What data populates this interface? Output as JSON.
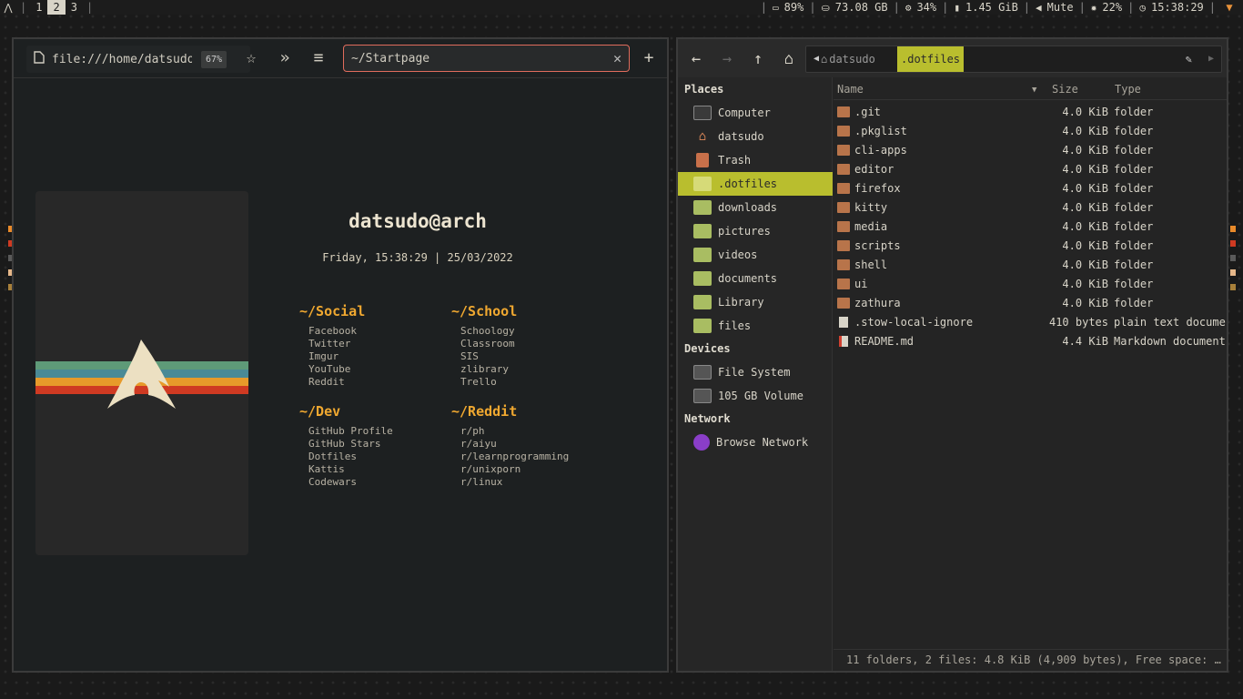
{
  "topbar": {
    "workspaces": [
      "1",
      "2",
      "3"
    ],
    "active_workspace": "2",
    "status": {
      "battery": "89%",
      "disk": "73.08 GB",
      "cpu": "34%",
      "memory": "1.45 GiB",
      "volume": "Mute",
      "brightness": "22%",
      "clock": "15:38:29"
    }
  },
  "browser": {
    "url": "file:///home/datsudo/",
    "zoom": "67%",
    "search_value": "~/Startpage",
    "startpage": {
      "host": "datsudo@arch",
      "datetime": "Friday, 15:38:29 | 25/03/2022",
      "sections": [
        {
          "title": "~/Social",
          "links": [
            "Facebook",
            "Twitter",
            "Imgur",
            "YouTube",
            "Reddit"
          ]
        },
        {
          "title": "~/School",
          "links": [
            "Schoology",
            "Classroom",
            "SIS",
            "zlibrary",
            "Trello"
          ]
        },
        {
          "title": "~/Dev",
          "links": [
            "GitHub Profile",
            "GitHub Stars",
            "Dotfiles",
            "Kattis",
            "Codewars"
          ]
        },
        {
          "title": "~/Reddit",
          "links": [
            "r/ph",
            "r/aiyu",
            "r/learnprogramming",
            "r/unixporn",
            "r/linux"
          ]
        }
      ]
    },
    "colors": {
      "accent": "#f0a830",
      "stripe_green": "#5e9a78",
      "stripe_blue": "#4a8a96",
      "stripe_orange": "#e79a2a",
      "stripe_red": "#cf3a22"
    }
  },
  "file_manager": {
    "breadcrumb": {
      "home": "datsudo",
      "current": ".dotfiles"
    },
    "sidebar": {
      "places_header": "Places",
      "places": [
        "Computer",
        "datsudo",
        "Trash",
        ".dotfiles",
        "downloads",
        "pictures",
        "videos",
        "documents",
        "Library",
        "files"
      ],
      "devices_header": "Devices",
      "devices": [
        "File System",
        "105 GB Volume"
      ],
      "network_header": "Network",
      "network": [
        "Browse Network"
      ]
    },
    "columns": {
      "name": "Name",
      "size": "Size",
      "type": "Type"
    },
    "files": [
      {
        "name": ".git",
        "size": "4.0 KiB",
        "type": "folder"
      },
      {
        "name": ".pkglist",
        "size": "4.0 KiB",
        "type": "folder"
      },
      {
        "name": "cli-apps",
        "size": "4.0 KiB",
        "type": "folder"
      },
      {
        "name": "editor",
        "size": "4.0 KiB",
        "type": "folder"
      },
      {
        "name": "firefox",
        "size": "4.0 KiB",
        "type": "folder"
      },
      {
        "name": "kitty",
        "size": "4.0 KiB",
        "type": "folder"
      },
      {
        "name": "media",
        "size": "4.0 KiB",
        "type": "folder"
      },
      {
        "name": "scripts",
        "size": "4.0 KiB",
        "type": "folder"
      },
      {
        "name": "shell",
        "size": "4.0 KiB",
        "type": "folder"
      },
      {
        "name": "ui",
        "size": "4.0 KiB",
        "type": "folder"
      },
      {
        "name": "zathura",
        "size": "4.0 KiB",
        "type": "folder"
      },
      {
        "name": ".stow-local-ignore",
        "size": "410 bytes",
        "type": "plain text document"
      },
      {
        "name": "README.md",
        "size": "4.4 KiB",
        "type": "Markdown document"
      }
    ],
    "status": "11 folders, 2 files: 4.8 KiB (4,909 bytes), Free space: …",
    "colors": {
      "selection": "#b9be2e",
      "folder": "#b8744a"
    }
  }
}
